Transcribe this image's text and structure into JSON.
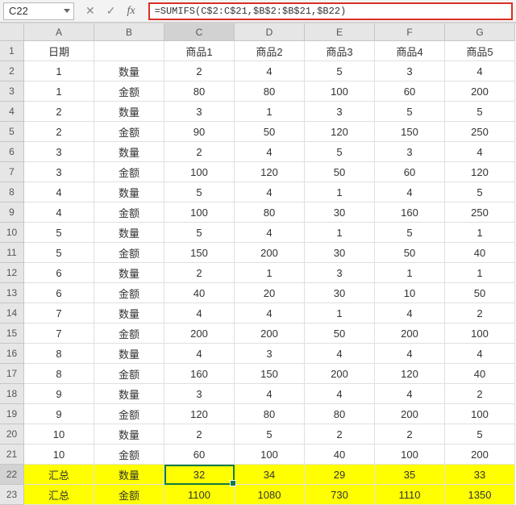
{
  "formula_bar": {
    "cell_ref": "C22",
    "cancel": "✕",
    "confirm": "✓",
    "fx": "fx",
    "formula": "=SUMIFS(C$2:C$21,$B$2:$B$21,$B22)"
  },
  "columns": [
    "A",
    "B",
    "C",
    "D",
    "E",
    "F",
    "G"
  ],
  "active_cell": "C22",
  "rows": [
    {
      "n": 1,
      "hl": false,
      "cells": [
        "日期",
        "",
        "商品1",
        "商品2",
        "商品3",
        "商品4",
        "商品5"
      ]
    },
    {
      "n": 2,
      "hl": false,
      "cells": [
        "1",
        "数量",
        "2",
        "4",
        "5",
        "3",
        "4"
      ]
    },
    {
      "n": 3,
      "hl": false,
      "cells": [
        "1",
        "金额",
        "80",
        "80",
        "100",
        "60",
        "200"
      ]
    },
    {
      "n": 4,
      "hl": false,
      "cells": [
        "2",
        "数量",
        "3",
        "1",
        "3",
        "5",
        "5"
      ]
    },
    {
      "n": 5,
      "hl": false,
      "cells": [
        "2",
        "金额",
        "90",
        "50",
        "120",
        "150",
        "250"
      ]
    },
    {
      "n": 6,
      "hl": false,
      "cells": [
        "3",
        "数量",
        "2",
        "4",
        "5",
        "3",
        "4"
      ]
    },
    {
      "n": 7,
      "hl": false,
      "cells": [
        "3",
        "金额",
        "100",
        "120",
        "50",
        "60",
        "120"
      ]
    },
    {
      "n": 8,
      "hl": false,
      "cells": [
        "4",
        "数量",
        "5",
        "4",
        "1",
        "4",
        "5"
      ]
    },
    {
      "n": 9,
      "hl": false,
      "cells": [
        "4",
        "金额",
        "100",
        "80",
        "30",
        "160",
        "250"
      ]
    },
    {
      "n": 10,
      "hl": false,
      "cells": [
        "5",
        "数量",
        "5",
        "4",
        "1",
        "5",
        "1"
      ]
    },
    {
      "n": 11,
      "hl": false,
      "cells": [
        "5",
        "金额",
        "150",
        "200",
        "30",
        "50",
        "40"
      ]
    },
    {
      "n": 12,
      "hl": false,
      "cells": [
        "6",
        "数量",
        "2",
        "1",
        "3",
        "1",
        "1"
      ]
    },
    {
      "n": 13,
      "hl": false,
      "cells": [
        "6",
        "金额",
        "40",
        "20",
        "30",
        "10",
        "50"
      ]
    },
    {
      "n": 14,
      "hl": false,
      "cells": [
        "7",
        "数量",
        "4",
        "4",
        "1",
        "4",
        "2"
      ]
    },
    {
      "n": 15,
      "hl": false,
      "cells": [
        "7",
        "金额",
        "200",
        "200",
        "50",
        "200",
        "100"
      ]
    },
    {
      "n": 16,
      "hl": false,
      "cells": [
        "8",
        "数量",
        "4",
        "3",
        "4",
        "4",
        "4"
      ]
    },
    {
      "n": 17,
      "hl": false,
      "cells": [
        "8",
        "金额",
        "160",
        "150",
        "200",
        "120",
        "40"
      ]
    },
    {
      "n": 18,
      "hl": false,
      "cells": [
        "9",
        "数量",
        "3",
        "4",
        "4",
        "4",
        "2"
      ]
    },
    {
      "n": 19,
      "hl": false,
      "cells": [
        "9",
        "金额",
        "120",
        "80",
        "80",
        "200",
        "100"
      ]
    },
    {
      "n": 20,
      "hl": false,
      "cells": [
        "10",
        "数量",
        "2",
        "5",
        "2",
        "2",
        "5"
      ]
    },
    {
      "n": 21,
      "hl": false,
      "cells": [
        "10",
        "金额",
        "60",
        "100",
        "40",
        "100",
        "200"
      ]
    },
    {
      "n": 22,
      "hl": true,
      "cells": [
        "汇总",
        "数量",
        "32",
        "34",
        "29",
        "35",
        "33"
      ]
    },
    {
      "n": 23,
      "hl": true,
      "cells": [
        "汇总",
        "金额",
        "1100",
        "1080",
        "730",
        "1110",
        "1350"
      ]
    }
  ]
}
